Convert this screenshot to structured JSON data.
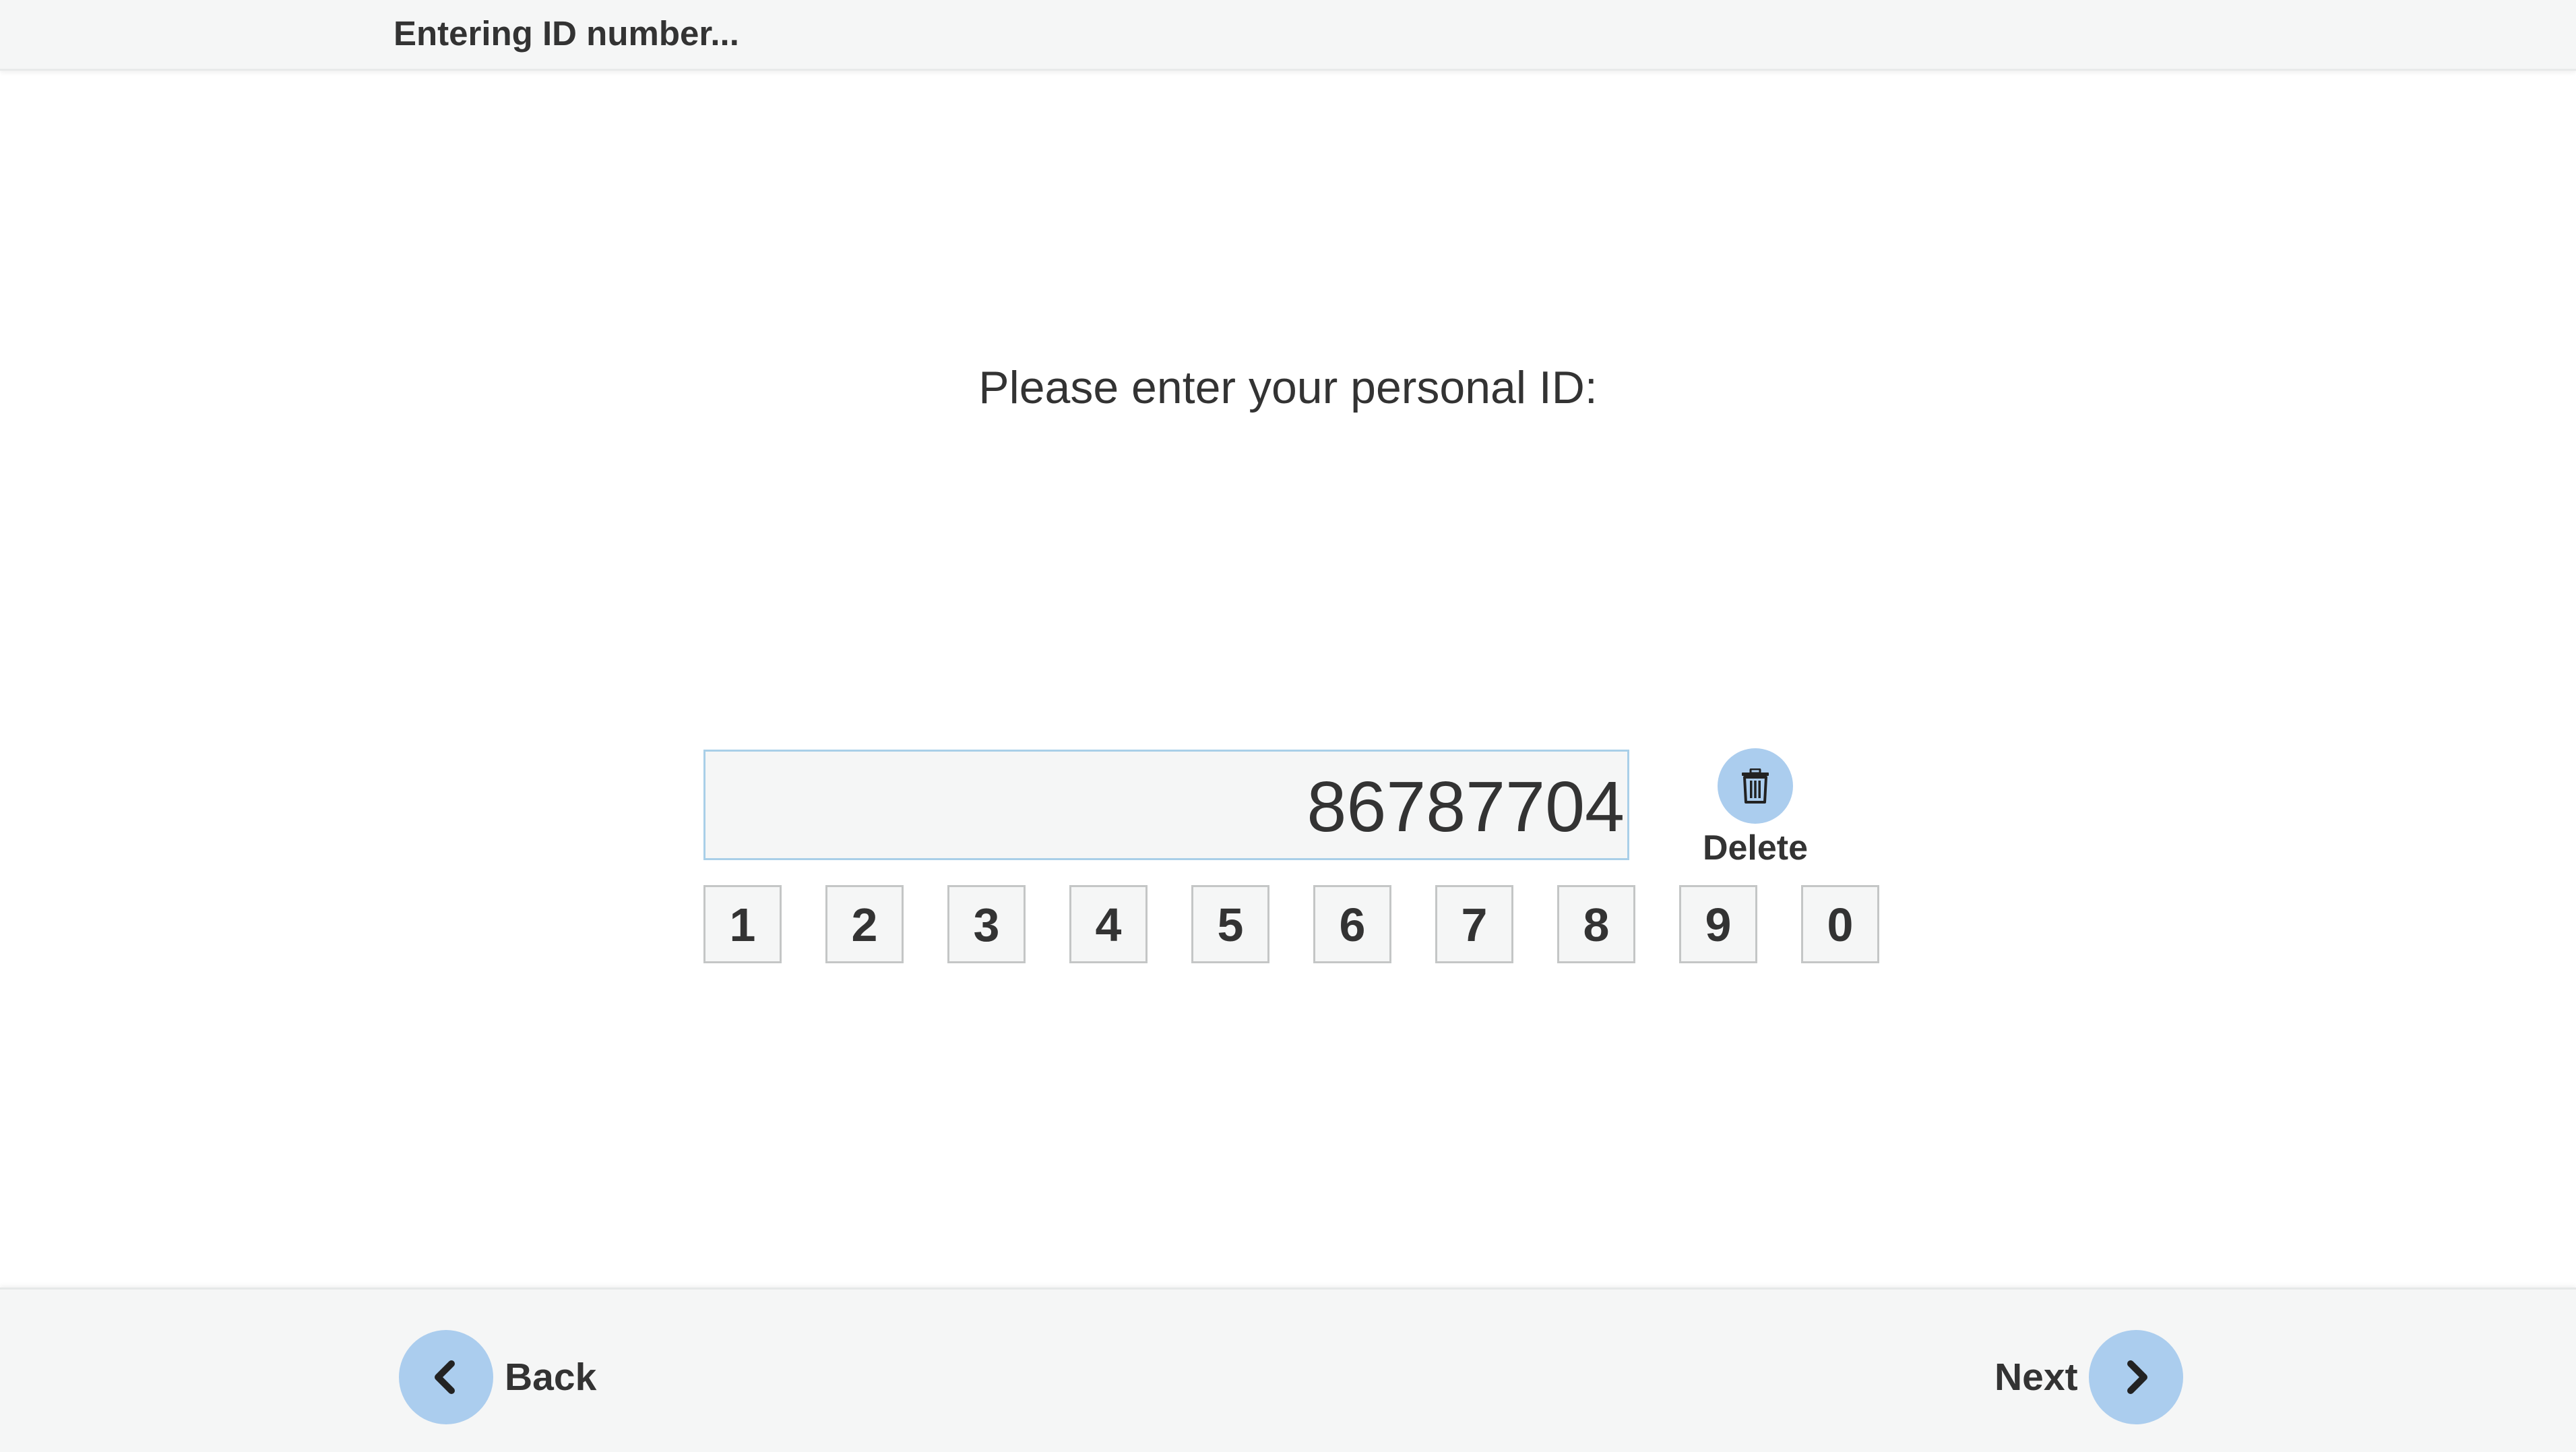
{
  "header": {
    "title": "Entering ID number..."
  },
  "prompt": {
    "text": "Please enter your personal ID:"
  },
  "id_entry": {
    "value": "86787704"
  },
  "delete_button": {
    "label": "Delete",
    "icon": "trash-icon",
    "color": "#abcdee"
  },
  "keypad": {
    "keys": [
      "1",
      "2",
      "3",
      "4",
      "5",
      "6",
      "7",
      "8",
      "9",
      "0"
    ]
  },
  "navigation": {
    "back_label": "Back",
    "back_icon": "chevron-left-icon",
    "next_label": "Next",
    "next_icon": "chevron-right-icon",
    "accent_color": "#abcdee"
  }
}
